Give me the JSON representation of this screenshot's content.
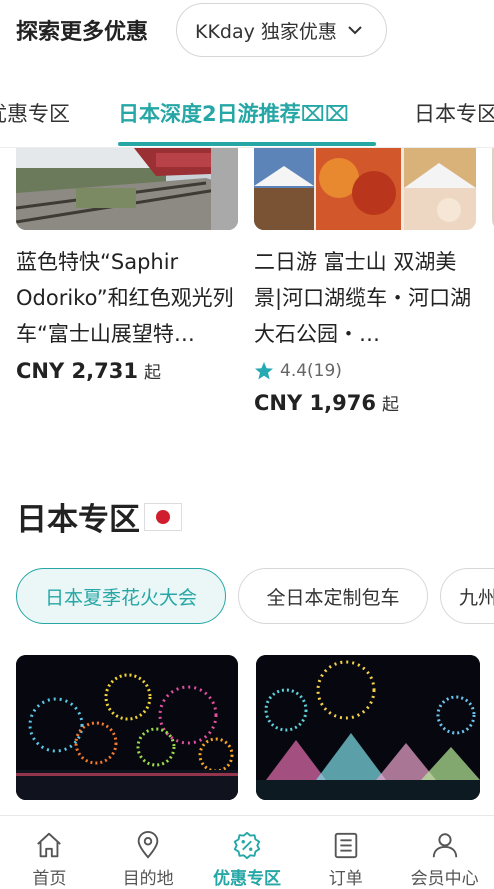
{
  "header": {
    "title": "探索更多优惠",
    "dropdown_value": "KKday 独家优惠"
  },
  "tabs": [
    {
      "label": "优惠专区"
    },
    {
      "label": "日本深度2日游推荐⌧⌧",
      "active": true
    },
    {
      "label": "日本专区"
    }
  ],
  "products": [
    {
      "title": "蓝色特快“Saphir Odoriko”和红色观光列车“富士山展望特…",
      "price": "CNY 2,731",
      "price_suffix": "起"
    },
    {
      "title": "二日游 富士山 双湖美景|河口湖缆车・河口湖大石公园・…",
      "rating": "4.4",
      "reviews": "(19)",
      "price": "CNY 1,976",
      "price_suffix": "起"
    }
  ],
  "section": {
    "title": "日本专区"
  },
  "chips": [
    {
      "label": "日本夏季花火大会",
      "active": true
    },
    {
      "label": "全日本定制包车"
    },
    {
      "label": "九州"
    }
  ],
  "bottom_nav": [
    {
      "label": "首页",
      "icon": "home-icon"
    },
    {
      "label": "目的地",
      "icon": "location-icon"
    },
    {
      "label": "优惠专区",
      "icon": "discount-icon",
      "active": true
    },
    {
      "label": "订单",
      "icon": "orders-icon"
    },
    {
      "label": "会员中心",
      "icon": "user-icon"
    }
  ],
  "colors": {
    "accent": "#26a7a6",
    "star": "#27a9b3"
  }
}
